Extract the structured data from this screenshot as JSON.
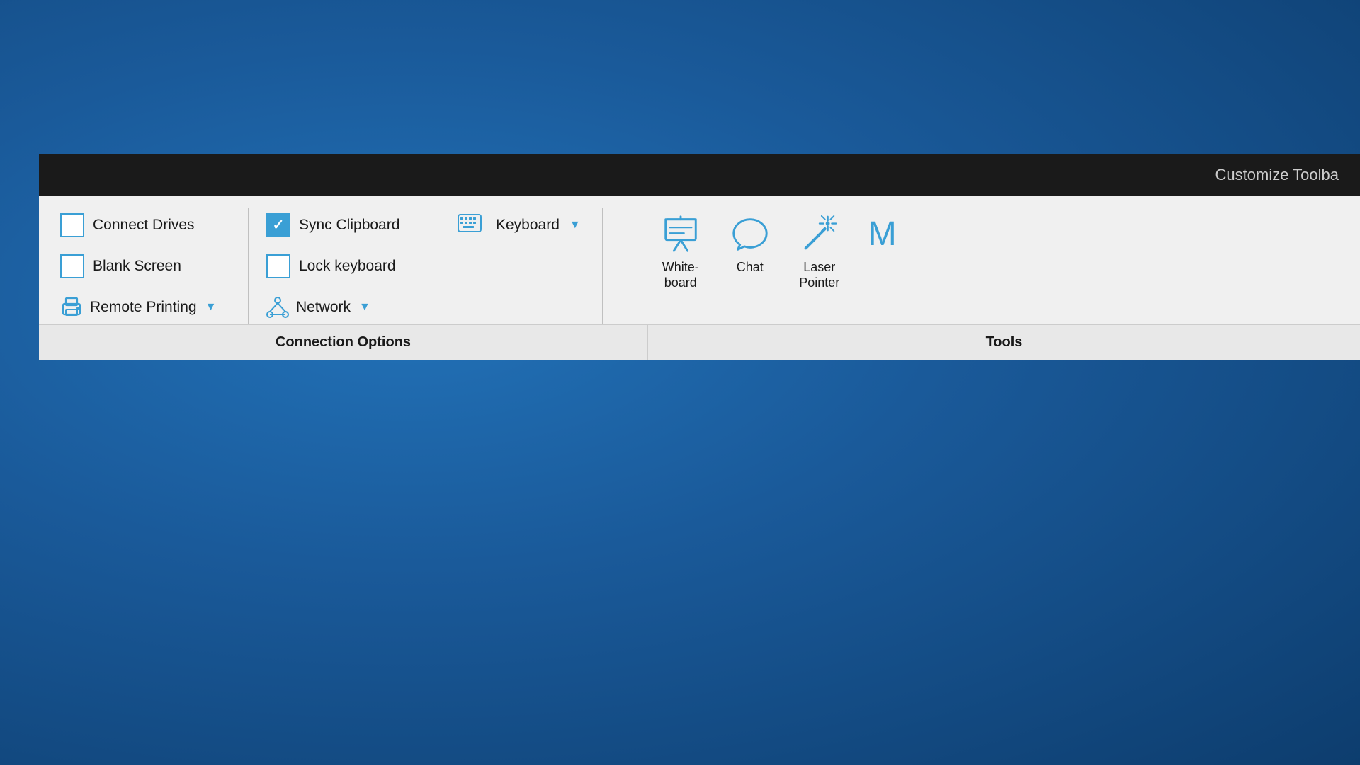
{
  "titlebar": {
    "customize_label": "Customize Toolba"
  },
  "connection_options": {
    "label": "Connection Options",
    "items": [
      {
        "id": "connect-drives",
        "type": "checkbox",
        "label": "Connect Drives",
        "checked": false
      },
      {
        "id": "blank-screen",
        "type": "checkbox",
        "label": "Blank Screen",
        "checked": false
      },
      {
        "id": "remote-printing",
        "type": "dropdown",
        "label": "Remote Printing",
        "has_arrow": true
      }
    ],
    "items_right": [
      {
        "id": "sync-clipboard",
        "type": "checkbox",
        "label": "Sync Clipboard",
        "checked": true
      },
      {
        "id": "lock-keyboard",
        "type": "checkbox",
        "label": "Lock keyboard",
        "checked": false
      },
      {
        "id": "network",
        "type": "dropdown",
        "label": "Network",
        "has_arrow": true
      }
    ],
    "keyboard": {
      "label": "Keyboard",
      "has_arrow": true
    }
  },
  "tools": {
    "label": "Tools",
    "items": [
      {
        "id": "whiteboard",
        "label": "White-\nboard",
        "label_line1": "White-",
        "label_line2": "board",
        "icon": "whiteboard-icon"
      },
      {
        "id": "chat",
        "label": "Chat",
        "label_line1": "Chat",
        "label_line2": "",
        "icon": "chat-icon"
      },
      {
        "id": "laser-pointer",
        "label": "Laser Pointer",
        "label_line1": "Laser",
        "label_line2": "Pointer",
        "icon": "laser-pointer-icon"
      },
      {
        "id": "more",
        "label": "M",
        "label_line1": "M",
        "label_line2": "",
        "icon": "more-icon"
      }
    ]
  },
  "colors": {
    "accent": "#3a9fd5",
    "background_dark": "#1a5a9a",
    "toolbar_bg": "#f0f0f0",
    "footer_bg": "#e8e8e8",
    "text_dark": "#1a1a1a",
    "titlebar_bg": "#1a1a1a"
  }
}
